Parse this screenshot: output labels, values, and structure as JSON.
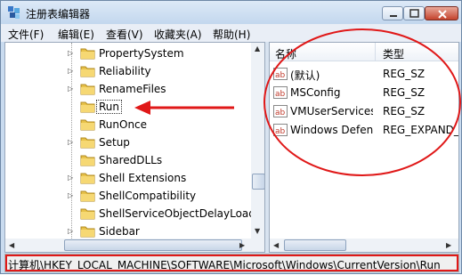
{
  "window": {
    "title": "注册表编辑器"
  },
  "menu": [
    "文件(F)",
    "编辑(E)",
    "查看(V)",
    "收藏夹(A)",
    "帮助(H)"
  ],
  "tree": {
    "items": [
      {
        "label": "PropertySystem",
        "selected": false,
        "expandable": true
      },
      {
        "label": "Reliability",
        "selected": false,
        "expandable": true
      },
      {
        "label": "RenameFiles",
        "selected": false,
        "expandable": true
      },
      {
        "label": "Run",
        "selected": true,
        "expandable": false
      },
      {
        "label": "RunOnce",
        "selected": false,
        "expandable": false
      },
      {
        "label": "Setup",
        "selected": false,
        "expandable": true
      },
      {
        "label": "SharedDLLs",
        "selected": false,
        "expandable": false
      },
      {
        "label": "Shell Extensions",
        "selected": false,
        "expandable": true
      },
      {
        "label": "ShellCompatibility",
        "selected": false,
        "expandable": true
      },
      {
        "label": "ShellServiceObjectDelayLoad",
        "selected": false,
        "expandable": false
      },
      {
        "label": "Sidebar",
        "selected": false,
        "expandable": true
      }
    ]
  },
  "list": {
    "columns": {
      "name": "名称",
      "type": "类型"
    },
    "rows": [
      {
        "name": "(默认)",
        "type": "REG_SZ"
      },
      {
        "name": "MSConfig",
        "type": "REG_SZ"
      },
      {
        "name": "VMUserServices",
        "type": "REG_SZ"
      },
      {
        "name": "Windows Defender",
        "type": "REG_EXPAND_SZ"
      }
    ]
  },
  "status": {
    "path": "计算机\\HKEY_LOCAL_MACHINE\\SOFTWARE\\Microsoft\\Windows\\CurrentVersion\\Run"
  },
  "colors": {
    "annotation": "#e01818",
    "folder": "#e8c24a"
  }
}
